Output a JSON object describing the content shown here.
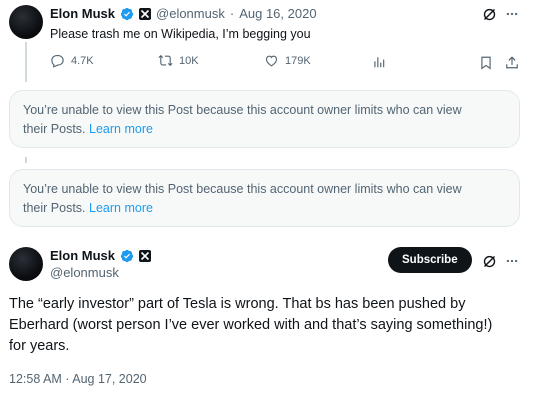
{
  "tweet1": {
    "author_name": "Elon Musk",
    "handle": "@elonmusk",
    "separator": "·",
    "date": "Aug 16, 2020",
    "text": "Please trash me on Wikipedia, I’m begging you",
    "replies": "4.7K",
    "retweets": "10K",
    "likes": "179K"
  },
  "notice1": {
    "line1": "You’re unable to view this Post because this account owner limits who can view",
    "line2_prefix": "their Posts.",
    "link": "Learn more"
  },
  "notice2": {
    "line1": "You’re unable to view this Post because this account owner limits who can view",
    "line2_prefix": "their Posts.",
    "link": "Learn more"
  },
  "main_tweet": {
    "author_name": "Elon Musk",
    "handle": "@elonmusk",
    "subscribe_label": "Subscribe",
    "text_line1": "The “early investor” part of Tesla is wrong. That bs has been pushed by",
    "text_line2": "Eberhard (worst person I’ve ever worked with and that’s saying something!)",
    "text_line3": "for years.",
    "timestamp": "12:58 AM · Aug 17, 2020"
  },
  "colors": {
    "verified_blue": "#1d9bf0",
    "link_blue": "#1d9bf0",
    "muted_gray": "#536471",
    "notice_bg": "#f7f9f9"
  },
  "icons": [
    "reply-icon",
    "retweet-icon",
    "like-icon",
    "views-icon",
    "bookmark-icon",
    "share-icon",
    "grok-icon",
    "more-icon",
    "verified-icon",
    "x-affiliate-icon"
  ]
}
